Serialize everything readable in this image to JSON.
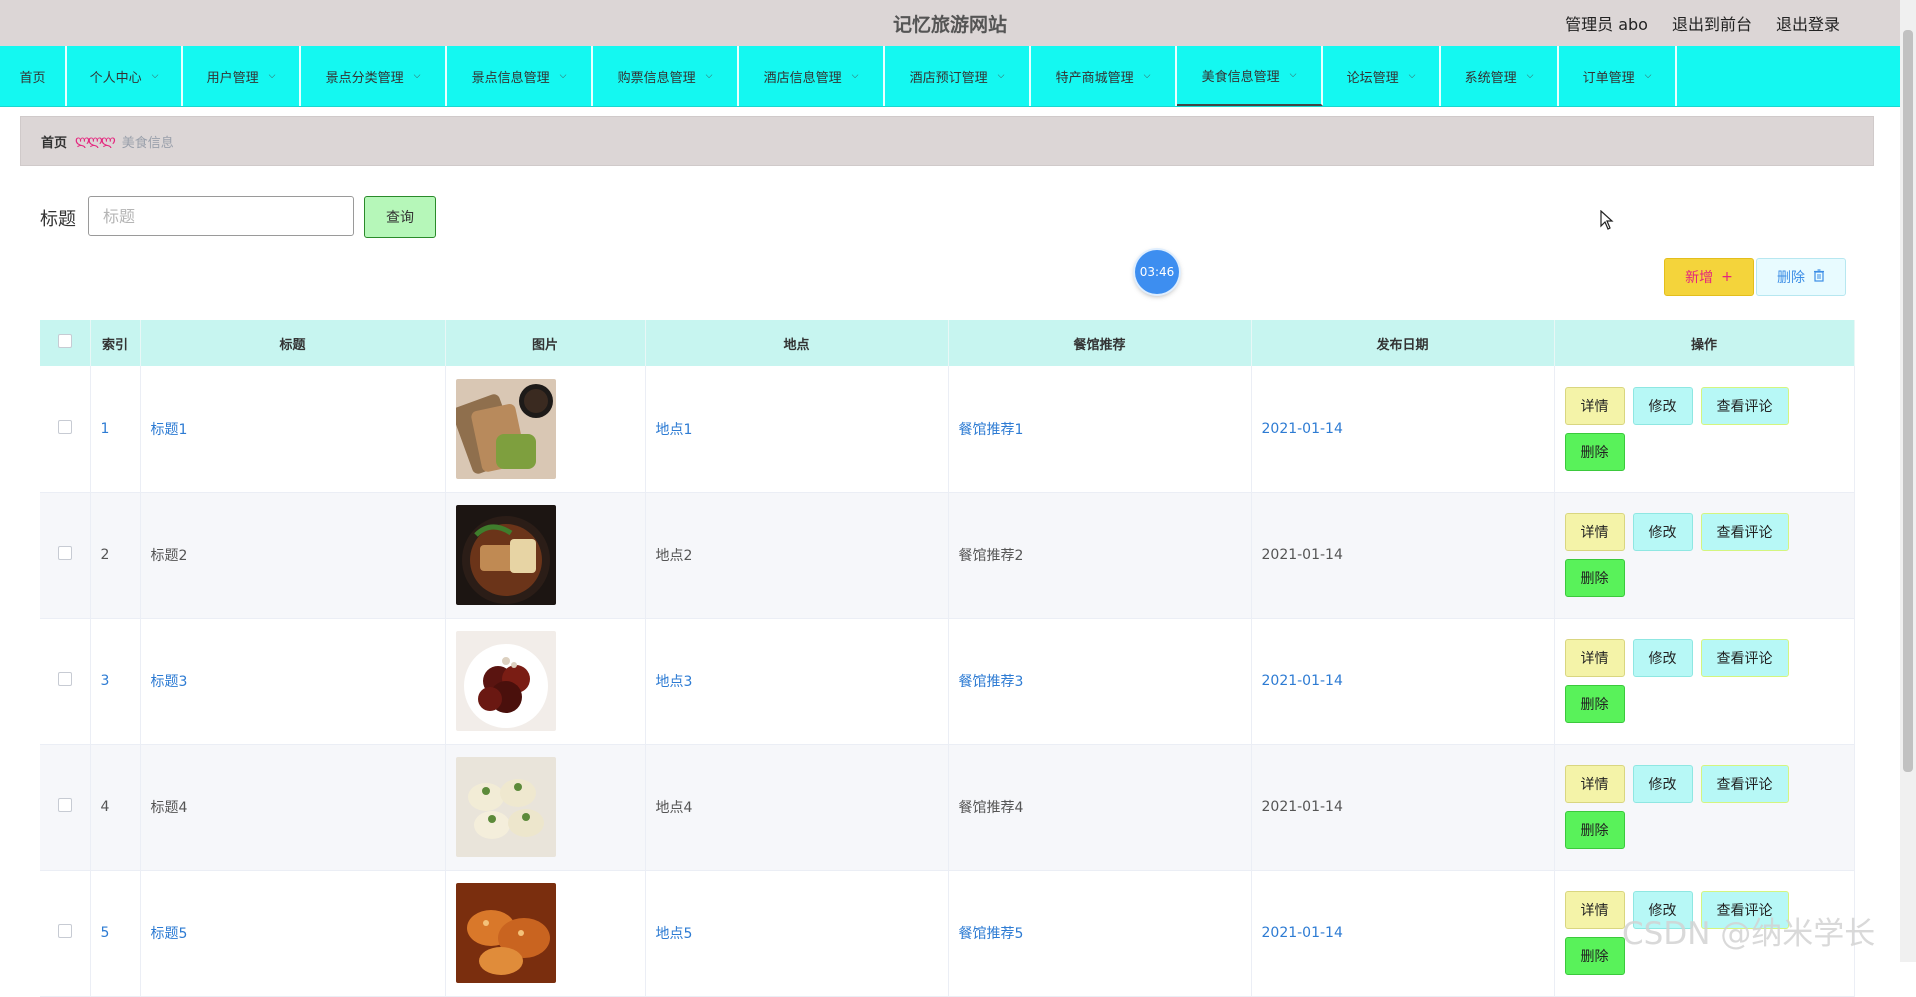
{
  "header": {
    "title": "记忆旅游网站",
    "links": [
      "管理员 abo",
      "退出到前台",
      "退出登录"
    ]
  },
  "nav": [
    {
      "label": "首页",
      "dropdown": false,
      "width": 67
    },
    {
      "label": "个人中心",
      "dropdown": true,
      "width": 116
    },
    {
      "label": "用户管理",
      "dropdown": true,
      "width": 118
    },
    {
      "label": "景点分类管理",
      "dropdown": true,
      "width": 146
    },
    {
      "label": "景点信息管理",
      "dropdown": true,
      "width": 146
    },
    {
      "label": "购票信息管理",
      "dropdown": true,
      "width": 146
    },
    {
      "label": "酒店信息管理",
      "dropdown": true,
      "width": 146
    },
    {
      "label": "酒店预订管理",
      "dropdown": true,
      "width": 146
    },
    {
      "label": "特产商城管理",
      "dropdown": true,
      "width": 146
    },
    {
      "label": "美食信息管理",
      "dropdown": true,
      "width": 146,
      "active": true
    },
    {
      "label": "论坛管理",
      "dropdown": true,
      "width": 118
    },
    {
      "label": "系统管理",
      "dropdown": true,
      "width": 118
    },
    {
      "label": "订单管理",
      "dropdown": true,
      "width": 118
    }
  ],
  "breadcrumb": {
    "home": "首页",
    "separator": "ლლლ",
    "current": "美食信息"
  },
  "search": {
    "label": "标题",
    "placeholder": "标题",
    "value": "",
    "button": "查询"
  },
  "timer": "03:46",
  "actions": {
    "add": "新增",
    "add_icon": "+",
    "delete": "删除",
    "delete_icon": "trash-icon"
  },
  "table": {
    "headers": [
      "索引",
      "标题",
      "图片",
      "地点",
      "餐馆推荐",
      "发布日期",
      "操作"
    ],
    "rows": [
      {
        "index": "1",
        "title": "标题1",
        "place": "地点1",
        "restaurant": "餐馆推荐1",
        "date": "2021-01-14",
        "image": "grilled-skewers"
      },
      {
        "index": "2",
        "title": "标题2",
        "place": "地点2",
        "restaurant": "餐馆推荐2",
        "date": "2021-01-14",
        "image": "braised-fish-pot"
      },
      {
        "index": "3",
        "title": "标题3",
        "place": "地点3",
        "restaurant": "餐馆推荐3",
        "date": "2021-01-14",
        "image": "braised-pork"
      },
      {
        "index": "4",
        "title": "标题4",
        "place": "地点4",
        "restaurant": "餐馆推荐4",
        "date": "2021-01-14",
        "image": "dumplings"
      },
      {
        "index": "5",
        "title": "标题5",
        "place": "地点5",
        "restaurant": "餐馆推荐5",
        "date": "2021-01-14",
        "image": "fried-chicken"
      }
    ],
    "row_buttons": {
      "detail": "详情",
      "edit": "修改",
      "comments": "查看评论",
      "delete": "删除"
    }
  },
  "watermark": "CSDN @纳米学长",
  "colors": {
    "nav_bg": "#14f8f1",
    "header_bg": "#dcd6d6",
    "link": "#2d7bd3",
    "accent_pink": "#e4257d"
  }
}
